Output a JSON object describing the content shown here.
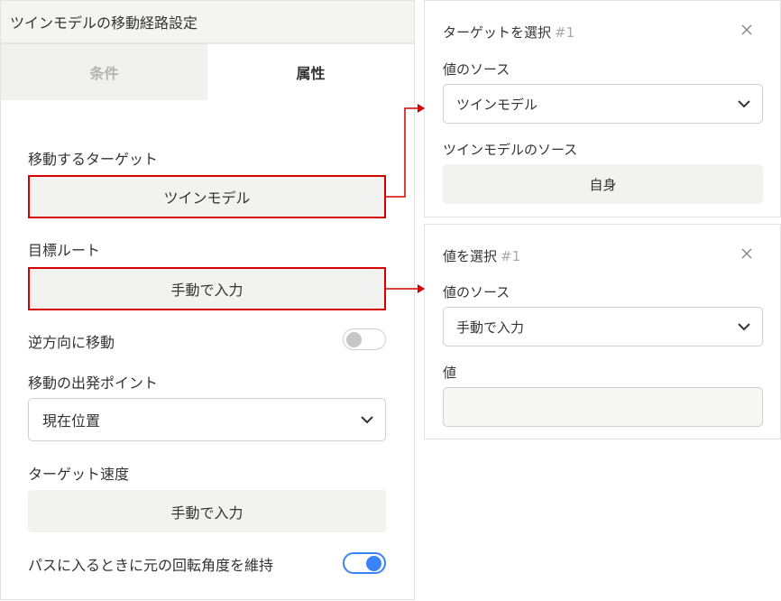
{
  "panel": {
    "title": "ツインモデルの移動経路設定",
    "tabs": [
      {
        "label": "条件",
        "active": false
      },
      {
        "label": "属性",
        "active": true
      }
    ],
    "target_label": "移動するターゲット",
    "target_value": "ツインモデル",
    "route_label": "目標ルート",
    "route_value": "手動で入力",
    "reverse_label": "逆方向に移動",
    "reverse_on": false,
    "start_label": "移動の出発ポイント",
    "start_value": "現在位置",
    "speed_label": "ターゲット速度",
    "speed_value": "手動で入力",
    "keep_rotation_label": "パスに入るときに元の回転角度を維持",
    "keep_rotation_on": true
  },
  "target_card": {
    "title": "ターゲットを選択",
    "number": "#1",
    "source_label": "値のソース",
    "source_value": "ツインモデル",
    "model_source_label": "ツインモデルのソース",
    "model_source_value": "自身"
  },
  "value_card": {
    "title": "値を選択",
    "number": "#1",
    "source_label": "値のソース",
    "source_value": "手動で入力",
    "value_label": "値",
    "value_input": ""
  },
  "colors": {
    "highlight": "#d40000",
    "toggle_on": "#3b82f6"
  },
  "icons": {
    "dropdown": "chevron-down-icon",
    "close": "close-icon"
  }
}
